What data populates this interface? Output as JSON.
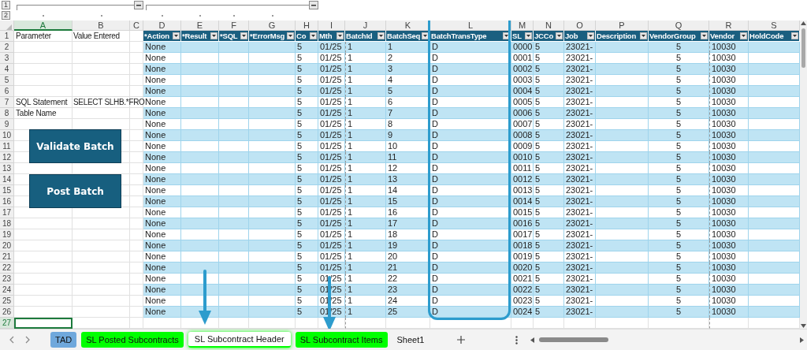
{
  "outline": {
    "levels": [
      "1",
      "2"
    ]
  },
  "columns": [
    {
      "letter": "A",
      "selected": true
    },
    {
      "letter": "B",
      "selected": false
    },
    {
      "letter": "C",
      "selected": false
    },
    {
      "letter": "D",
      "selected": false
    },
    {
      "letter": "E",
      "selected": false
    },
    {
      "letter": "F",
      "selected": false
    },
    {
      "letter": "G",
      "selected": false
    },
    {
      "letter": "H",
      "selected": false
    },
    {
      "letter": "I",
      "selected": false
    },
    {
      "letter": "J",
      "selected": false
    },
    {
      "letter": "K",
      "selected": false
    },
    {
      "letter": "L",
      "selected": false
    },
    {
      "letter": "M",
      "selected": false
    },
    {
      "letter": "N",
      "selected": false
    },
    {
      "letter": "O",
      "selected": false
    },
    {
      "letter": "P",
      "selected": false
    },
    {
      "letter": "Q",
      "selected": false
    },
    {
      "letter": "R",
      "selected": false
    },
    {
      "letter": "S",
      "selected": false
    }
  ],
  "rows": [
    {
      "number": "1",
      "selected": false,
      "a": "Parameter",
      "b": "Value Entered"
    },
    {
      "number": "2",
      "selected": false
    },
    {
      "number": "3",
      "selected": false
    },
    {
      "number": "4",
      "selected": false
    },
    {
      "number": "5",
      "selected": false
    },
    {
      "number": "6",
      "selected": false
    },
    {
      "number": "7",
      "selected": false,
      "a": "SQL Statement",
      "b": "SELECT SLHB.*FRO"
    },
    {
      "number": "8",
      "selected": false,
      "a": "Table Name"
    },
    {
      "number": "9",
      "selected": false
    },
    {
      "number": "10",
      "selected": false
    },
    {
      "number": "11",
      "selected": false
    },
    {
      "number": "12",
      "selected": false
    },
    {
      "number": "13",
      "selected": false
    },
    {
      "number": "14",
      "selected": false
    },
    {
      "number": "15",
      "selected": false
    },
    {
      "number": "16",
      "selected": false
    },
    {
      "number": "17",
      "selected": false
    },
    {
      "number": "18",
      "selected": false
    },
    {
      "number": "19",
      "selected": false
    },
    {
      "number": "20",
      "selected": false
    },
    {
      "number": "21",
      "selected": false
    },
    {
      "number": "22",
      "selected": false
    },
    {
      "number": "23",
      "selected": false
    },
    {
      "number": "24",
      "selected": false
    },
    {
      "number": "25",
      "selected": false
    },
    {
      "number": "26",
      "selected": false
    },
    {
      "number": "27",
      "selected": true
    }
  ],
  "table": {
    "columns": [
      "*Action",
      "*Result",
      "*SQL",
      "*ErrorMsg",
      "Co",
      "Mth",
      "BatchId",
      "BatchSeq",
      "BatchTransType",
      "SL",
      "JCCo",
      "Job",
      "Description",
      "VendorGroup",
      "Vendor",
      "HoldCode"
    ],
    "rows": [
      [
        "None",
        null,
        null,
        null,
        "5",
        "01/25",
        "1",
        "1",
        "D",
        "0000",
        "5",
        "23021-",
        null,
        "5",
        "10030",
        null
      ],
      [
        "None",
        null,
        null,
        null,
        "5",
        "01/25",
        "1",
        "2",
        "D",
        "0001",
        "5",
        "23021-",
        null,
        "5",
        "10030",
        null
      ],
      [
        "None",
        null,
        null,
        null,
        "5",
        "01/25",
        "1",
        "3",
        "D",
        "0002",
        "5",
        "23021-",
        null,
        "5",
        "10030",
        null
      ],
      [
        "None",
        null,
        null,
        null,
        "5",
        "01/25",
        "1",
        "4",
        "D",
        "0003",
        "5",
        "23021-",
        null,
        "5",
        "10030",
        null
      ],
      [
        "None",
        null,
        null,
        null,
        "5",
        "01/25",
        "1",
        "5",
        "D",
        "0004",
        "5",
        "23021-",
        null,
        "5",
        "10030",
        null
      ],
      [
        "None",
        null,
        null,
        null,
        "5",
        "01/25",
        "1",
        "6",
        "D",
        "0005",
        "5",
        "23021-",
        null,
        "5",
        "10030",
        null
      ],
      [
        "None",
        null,
        null,
        null,
        "5",
        "01/25",
        "1",
        "7",
        "D",
        "0006",
        "5",
        "23021-",
        null,
        "5",
        "10030",
        null
      ],
      [
        "None",
        null,
        null,
        null,
        "5",
        "01/25",
        "1",
        "8",
        "D",
        "0007",
        "5",
        "23021-",
        null,
        "5",
        "10030",
        null
      ],
      [
        "None",
        null,
        null,
        null,
        "5",
        "01/25",
        "1",
        "9",
        "D",
        "0008",
        "5",
        "23021-",
        null,
        "5",
        "10030",
        null
      ],
      [
        "None",
        null,
        null,
        null,
        "5",
        "01/25",
        "1",
        "10",
        "D",
        "0009",
        "5",
        "23021-",
        null,
        "5",
        "10030",
        null
      ],
      [
        "None",
        null,
        null,
        null,
        "5",
        "01/25",
        "1",
        "11",
        "D",
        "0010",
        "5",
        "23021-",
        null,
        "5",
        "10030",
        null
      ],
      [
        "None",
        null,
        null,
        null,
        "5",
        "01/25",
        "1",
        "12",
        "D",
        "0011",
        "5",
        "23021-",
        null,
        "5",
        "10030",
        null
      ],
      [
        "None",
        null,
        null,
        null,
        "5",
        "01/25",
        "1",
        "13",
        "D",
        "0012",
        "5",
        "23021-",
        null,
        "5",
        "10030",
        null
      ],
      [
        "None",
        null,
        null,
        null,
        "5",
        "01/25",
        "1",
        "14",
        "D",
        "0013",
        "5",
        "23021-",
        null,
        "5",
        "10030",
        null
      ],
      [
        "None",
        null,
        null,
        null,
        "5",
        "01/25",
        "1",
        "15",
        "D",
        "0014",
        "5",
        "23021-",
        null,
        "5",
        "10030",
        null
      ],
      [
        "None",
        null,
        null,
        null,
        "5",
        "01/25",
        "1",
        "16",
        "D",
        "0015",
        "5",
        "23021-",
        null,
        "5",
        "10030",
        null
      ],
      [
        "None",
        null,
        null,
        null,
        "5",
        "01/25",
        "1",
        "17",
        "D",
        "0016",
        "5",
        "23021-",
        null,
        "5",
        "10030",
        null
      ],
      [
        "None",
        null,
        null,
        null,
        "5",
        "01/25",
        "1",
        "18",
        "D",
        "0017",
        "5",
        "23021-",
        null,
        "5",
        "10030",
        null
      ],
      [
        "None",
        null,
        null,
        null,
        "5",
        "01/25",
        "1",
        "19",
        "D",
        "0018",
        "5",
        "23021-",
        null,
        "5",
        "10030",
        null
      ],
      [
        "None",
        null,
        null,
        null,
        "5",
        "01/25",
        "1",
        "20",
        "D",
        "0019",
        "5",
        "23021-",
        null,
        "5",
        "10030",
        null
      ],
      [
        "None",
        null,
        null,
        null,
        "5",
        "01/25",
        "1",
        "21",
        "D",
        "0020",
        "5",
        "23021-",
        null,
        "5",
        "10030",
        null
      ],
      [
        "None",
        null,
        null,
        null,
        "5",
        "01/25",
        "1",
        "22",
        "D",
        "0021",
        "5",
        "23021-",
        null,
        "5",
        "10030",
        null
      ],
      [
        "None",
        null,
        null,
        null,
        "5",
        "01/25",
        "1",
        "23",
        "D",
        "0022",
        "5",
        "23021-",
        null,
        "5",
        "10030",
        null
      ],
      [
        "None",
        null,
        null,
        null,
        "5",
        "01/25",
        "1",
        "24",
        "D",
        "0023",
        "5",
        "23021-",
        null,
        "5",
        "10030",
        null
      ],
      [
        "None",
        null,
        null,
        null,
        "5",
        "01/25",
        "1",
        "25",
        "D",
        "0024",
        "5",
        "23021-",
        null,
        "5",
        "10030",
        null
      ]
    ]
  },
  "buttons": [
    "Validate Batch",
    "Post Batch"
  ],
  "tabs": [
    {
      "label": "TAD",
      "color": "#6fa8dc",
      "selected": false
    },
    {
      "label": "SL Posted Subcontracts",
      "color": "#00ff00",
      "selected": false
    },
    {
      "label": "SL Subcontract Header",
      "color": "#00ff00",
      "selected": true
    },
    {
      "label": "SL Subcontract Items",
      "color": "#00ff00",
      "selected": false
    },
    {
      "label": "Sheet1",
      "selected": false
    }
  ]
}
